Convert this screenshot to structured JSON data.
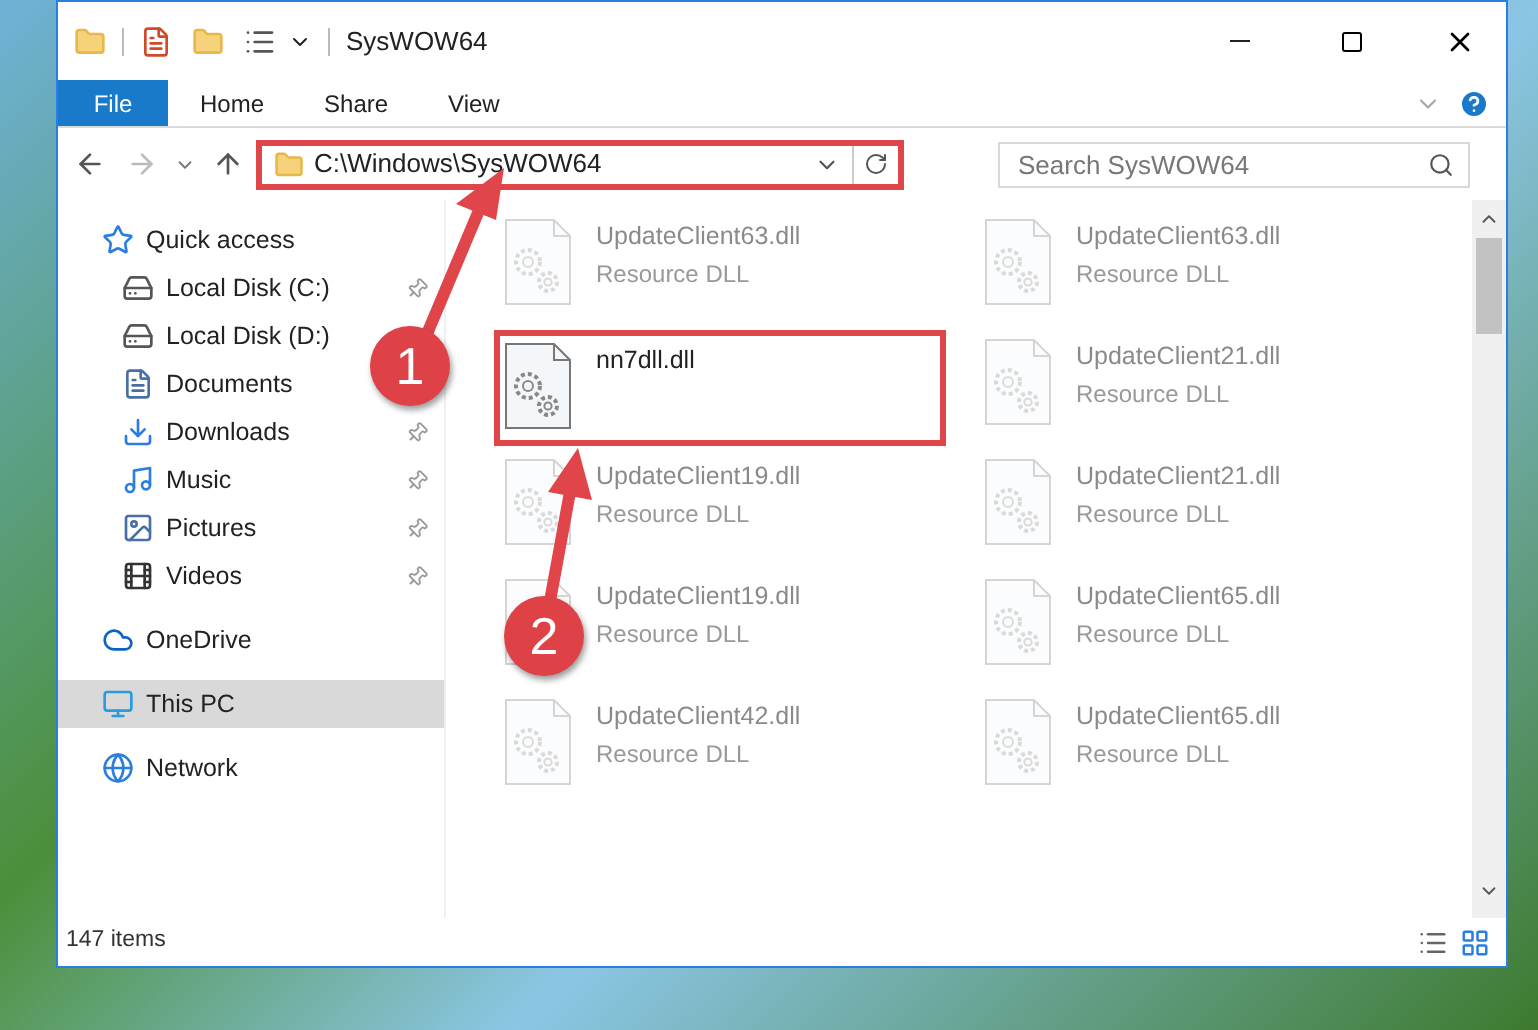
{
  "window": {
    "title": "SysWOW64"
  },
  "ribbon_tabs": [
    {
      "label": "File",
      "selected": true
    },
    {
      "label": "Home",
      "selected": false
    },
    {
      "label": "Share",
      "selected": false
    },
    {
      "label": "View",
      "selected": false
    }
  ],
  "address_bar": {
    "path": "C:\\Windows\\SysWOW64",
    "highlighted": true
  },
  "search": {
    "placeholder": "Search SysWOW64"
  },
  "sidebar": {
    "items": [
      {
        "label": "Quick access",
        "selected": false,
        "children": [
          {
            "label": "Local Disk (C:)",
            "pinned": true,
            "selected": false
          },
          {
            "label": "Local Disk (D:)",
            "pinned": false,
            "selected": false
          },
          {
            "label": "Documents",
            "pinned": false,
            "selected": false
          },
          {
            "label": "Downloads",
            "pinned": true,
            "selected": false
          },
          {
            "label": "Music",
            "pinned": true,
            "selected": false
          },
          {
            "label": "Pictures",
            "pinned": true,
            "selected": false
          },
          {
            "label": "Videos",
            "pinned": true,
            "selected": false
          }
        ]
      },
      {
        "label": "OneDrive",
        "selected": false
      },
      {
        "label": "This PC",
        "selected": true
      },
      {
        "label": "Network",
        "selected": false
      }
    ]
  },
  "files": [
    {
      "name": "UpdateClient63.dll",
      "type": "Resource DLL",
      "faded": true,
      "highlighted": false
    },
    {
      "name": "UpdateClient63.dll",
      "type": "Resource DLL",
      "faded": true,
      "highlighted": false
    },
    {
      "name": "nn7dll.dll",
      "faded": false,
      "highlighted": true
    },
    {
      "name": "UpdateClient21.dll",
      "type": "Resource DLL",
      "faded": true,
      "highlighted": false
    },
    {
      "name": "UpdateClient19.dll",
      "type": "Resource DLL",
      "faded": true,
      "highlighted": false
    },
    {
      "name": "UpdateClient21.dll",
      "type": "Resource DLL",
      "faded": true,
      "highlighted": false
    },
    {
      "name": "UpdateClient19.dll",
      "type": "Resource DLL",
      "faded": true,
      "highlighted": false
    },
    {
      "name": "UpdateClient65.dll",
      "type": "Resource DLL",
      "faded": true,
      "highlighted": false
    },
    {
      "name": "UpdateClient42.dll",
      "type": "Resource DLL",
      "faded": true,
      "highlighted": false
    },
    {
      "name": "UpdateClient65.dll",
      "type": "Resource DLL",
      "faded": true,
      "highlighted": false
    }
  ],
  "status_bar": {
    "count": "147 items"
  },
  "callouts": [
    {
      "number": "1"
    },
    {
      "number": "2"
    }
  ]
}
